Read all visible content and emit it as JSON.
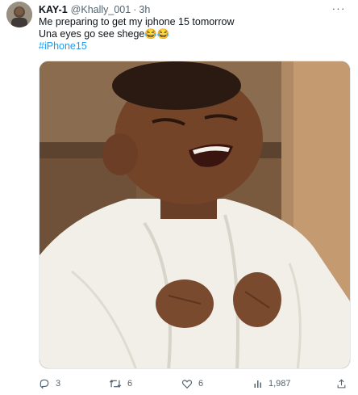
{
  "tweet": {
    "author_name": "KAY-1",
    "author_handle": "@Khally_001",
    "separator": "·",
    "timestamp": "3h",
    "text_line1": "Me preparing to get my iphone 15 tomorrow",
    "text_line2": "Una eyes go see shege😂😂",
    "hashtag": "#iPhone15",
    "more_label": "···"
  },
  "actions": {
    "replies": "3",
    "retweets": "6",
    "likes": "6",
    "views": "1,987"
  },
  "colors": {
    "link": "#1d9bf0",
    "secondary_text": "#536471",
    "primary_text": "#0f1419"
  },
  "icons": [
    "reply-icon",
    "retweet-icon",
    "like-icon",
    "views-icon",
    "share-icon",
    "more-icon"
  ]
}
